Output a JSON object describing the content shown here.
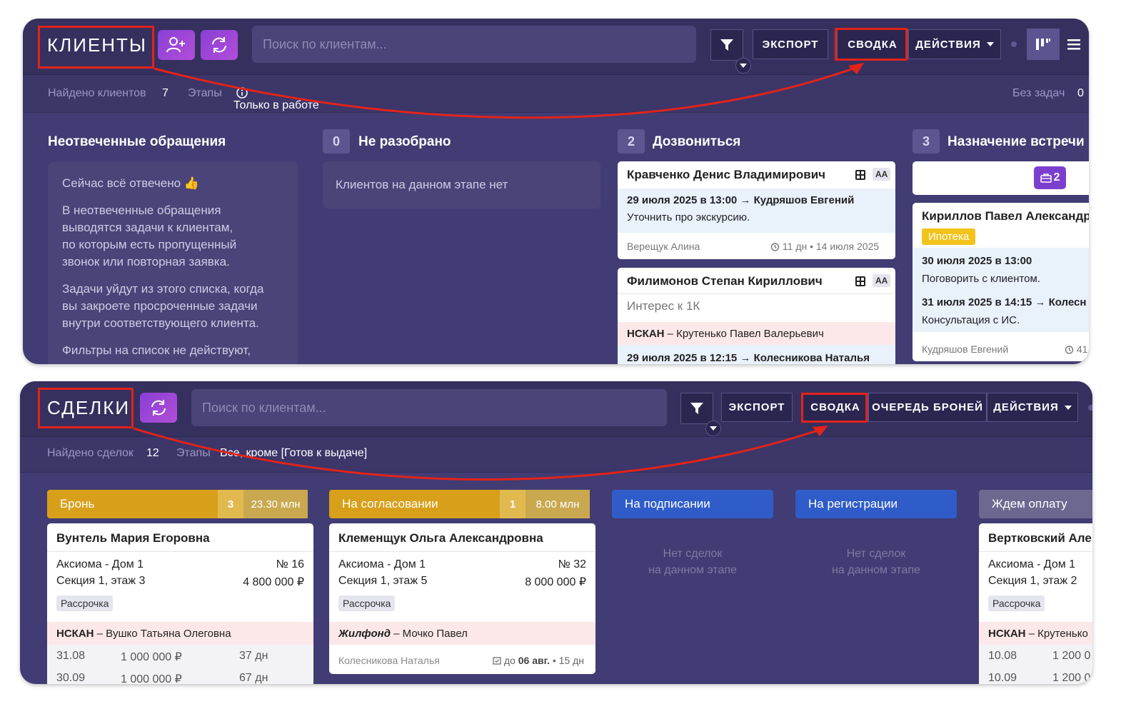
{
  "clients": {
    "title": "КЛИЕНТЫ",
    "search_placeholder": "Поиск по клиентам...",
    "buttons": {
      "export": "ЭКСПОРТ",
      "summary": "СВОДКА",
      "actions": "ДЕЙСТВИЯ"
    },
    "subbar": {
      "found_label": "Найдено клиентов",
      "found_value": "7",
      "stages_label": "Этапы",
      "stages_value": "Только в работе",
      "no_tasks_label": "Без задач",
      "no_tasks_value": "0"
    },
    "columns": {
      "unanswered": {
        "title": "Неотвеченные обращения",
        "p1": "Сейчас всё отвечено 👍",
        "p2": [
          "В неотвеченные обращения",
          "выводятся задачи к клиентам,",
          "по которым есть пропущенный",
          "звонок или повторная заявка."
        ],
        "p3": [
          "Задачи уйдут из этого списка, когда",
          "вы закроете просроченные задачи",
          "внутри соответствующего клиента."
        ],
        "p4": "Фильтры на список не действуют,"
      },
      "unsorted": {
        "count": "0",
        "title": "Не разобрано",
        "empty": "Клиентов на данном этапе нет"
      },
      "call": {
        "count": "2",
        "title": "Дозвониться",
        "card1": {
          "name": "Кравченко Денис Владимирович",
          "badge": "AA",
          "task": "29 июля 2025 в 13:00 → Кудряшов Евгений",
          "note": "Уточнить про экскурсию.",
          "manager": "Верещук Алина",
          "meta": "11 дн • 14 июля 2025"
        },
        "card2": {
          "name": "Филимонов Степан Кириллович",
          "badge": "AA",
          "interest": "Интерес к 1К",
          "agency": "НСКАН",
          "agent": " – Крутенько Павел Валерьевич",
          "task": "29 июля 2025 в 12:15 → Колесникова Наталья"
        }
      },
      "meeting": {
        "count": "3",
        "title": "Назначение встречи",
        "bag_count": "2",
        "card1": {
          "name": "Кириллов Павел Александр",
          "tag": "Ипотека",
          "task1": "30 июля 2025 в 13:00",
          "note1": "Поговорить с клиентом.",
          "task2": "31 июля 2025 в 14:15 → Колесн",
          "note2": "Консультация с ИС.",
          "manager": "Кудряшов Евгений",
          "meta": "41"
        }
      }
    }
  },
  "deals": {
    "title": "СДЕЛКИ",
    "search_placeholder": "Поиск по клиентам...",
    "buttons": {
      "export": "ЭКСПОРТ",
      "summary": "СВОДКА",
      "queue": "ОЧЕРЕДЬ БРОНЕЙ",
      "actions": "ДЕЙСТВИЯ"
    },
    "subbar": {
      "found_label": "Найдено сделок",
      "found_value": "12",
      "stages_label": "Этапы",
      "stages_value": "Все, кроме [Готов к выдаче]"
    },
    "stages": [
      {
        "label": "Бронь",
        "count": "3",
        "amount": "23.30 млн",
        "color": "#d8a01a"
      },
      {
        "label": "На согласовании",
        "count": "1",
        "amount": "8.00 млн",
        "color": "#d8a01a"
      },
      {
        "label": "На подписании",
        "color": "#2f5cc9"
      },
      {
        "label": "На регистрации",
        "color": "#2f5cc9"
      },
      {
        "label": "Ждем оплату",
        "color": "#6c6890"
      }
    ],
    "empty_text_1": "Нет сделок",
    "empty_text_2": "на данном этапе",
    "cards": {
      "c1": {
        "name": "Вунтель Мария Егоровна",
        "project": "Аксиома - Дом 1",
        "number": "№ 16",
        "section": "Секция 1, этаж 3",
        "price": "4 800 000 ₽",
        "tag": "Рассрочка",
        "agency": "НСКАН",
        "agent": " – Вушко Татьяна Олеговна",
        "pay1_date": "31.08",
        "pay1_sum": "1 000 000 ₽",
        "pay1_days": "37 дн",
        "pay2_date": "30.09",
        "pay2_sum": "1 000 000 ₽",
        "pay2_days": "67 дн"
      },
      "c2": {
        "name": "Клеменщук Ольга Александровна",
        "project": "Аксиома - Дом 1",
        "number": "№ 32",
        "section": "Секция 1, этаж 5",
        "price": "8 000 000 ₽",
        "tag": "Рассрочка",
        "agency": "Жилфонд",
        "agent": " – Мочко Павел",
        "manager": "Колесникова Наталья",
        "due_prefix": "до ",
        "due_date": "06 авг.",
        "due_suffix": " • 15 дн"
      },
      "c3": {
        "name": "Вертковский Алек",
        "project": "Аксиома - Дом 1",
        "section": "Секция 1, этаж 2",
        "tag": "Рассрочка",
        "agency": "НСКАН",
        "agent": " – Крутенько",
        "pay1_date": "10.08",
        "pay1_sum": "1 200 0",
        "pay2_date": "10.09",
        "pay2_sum": "1 200 0"
      }
    }
  },
  "colors": {
    "panel_bg": "#413c73",
    "accent_purple": "#9b45d8",
    "annotation_red": "#e2231a"
  }
}
